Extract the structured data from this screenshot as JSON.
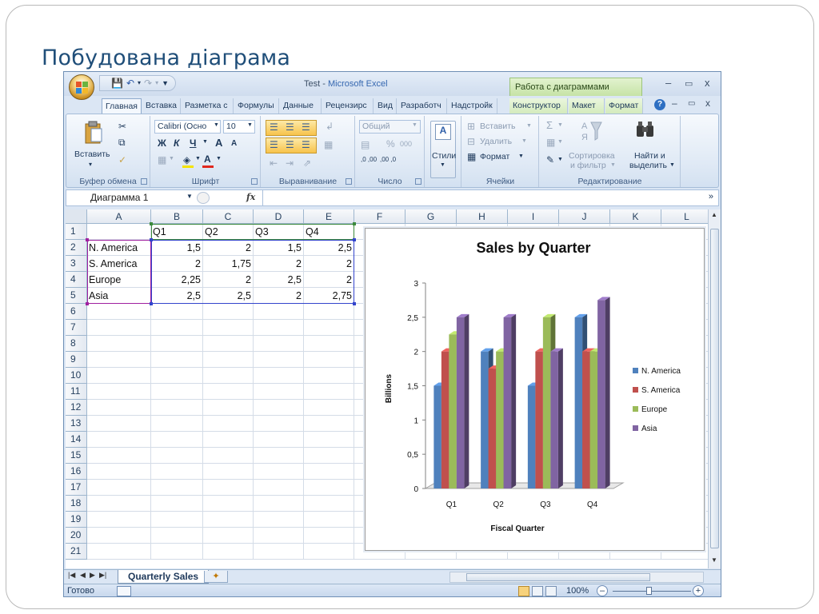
{
  "slide": {
    "title": "Побудована діаграма"
  },
  "window": {
    "title_file": "Test",
    "title_sep": " - ",
    "title_app": "Microsoft Excel",
    "context_title": "Работа с диаграммами",
    "minimize": "–",
    "maximize": "▭",
    "close": "x",
    "doc_minimize": "–",
    "doc_restore": "▭",
    "doc_close": "x",
    "help": "?"
  },
  "qat": {
    "save_icon": "save-icon",
    "undo_icon": "undo-icon",
    "redo_icon": "redo-icon"
  },
  "tabs": [
    "Главная",
    "Вставка",
    "Разметка с",
    "Формулы",
    "Данные",
    "Рецензирс",
    "Вид",
    "Разработч",
    "Надстройк",
    "Конструктор",
    "Макет",
    "Формат"
  ],
  "ribbon": {
    "clipboard": {
      "paste": "Вставить",
      "label": "Буфер обмена"
    },
    "font": {
      "name": "Calibri (Осно",
      "size": "10",
      "bold": "Ж",
      "italic": "К",
      "underline": "Ч",
      "grow": "A",
      "shrink": "A",
      "color_letter": "A",
      "label": "Шрифт"
    },
    "alignment": {
      "label": "Выравнивание"
    },
    "number": {
      "format": "Общий",
      "percent": "%",
      "thousands": "000",
      "inc": ",0 ,00",
      "dec": ",00 ,0",
      "label": "Число"
    },
    "styles": {
      "label": "Стили"
    },
    "cells": {
      "insert": "Вставить",
      "delete": "Удалить",
      "format": "Формат",
      "label": "Ячейки"
    },
    "editing": {
      "sum": "Σ",
      "sort_line1": "Сортировка",
      "sort_line2": "и фильтр",
      "find_line1": "Найти и",
      "find_line2": "выделить",
      "label": "Редактирование"
    }
  },
  "formula_bar": {
    "name_box": "Диаграмма 1",
    "fx": "fx",
    "formula": ""
  },
  "columns": [
    "A",
    "B",
    "C",
    "D",
    "E",
    "F",
    "G",
    "H",
    "I",
    "J",
    "K",
    "L"
  ],
  "rows": [
    "1",
    "2",
    "3",
    "4",
    "5",
    "6",
    "7",
    "8",
    "9",
    "10",
    "11",
    "12",
    "13",
    "14",
    "15",
    "16",
    "17",
    "18",
    "19",
    "20",
    "21"
  ],
  "table": {
    "header": [
      "",
      "Q1",
      "Q2",
      "Q3",
      "Q4"
    ],
    "rows": [
      [
        "N. America",
        "1,5",
        "2",
        "1,5",
        "2,5"
      ],
      [
        "S. America",
        "2",
        "1,75",
        "2",
        "2"
      ],
      [
        "Europe",
        "2,25",
        "2",
        "2,5",
        "2"
      ],
      [
        "Asia",
        "2,5",
        "2,5",
        "2",
        "2,75"
      ]
    ]
  },
  "chart_data": {
    "type": "bar",
    "title": "Sales by Quarter",
    "xlabel": "Fiscal Quarter",
    "ylabel": "Billions",
    "categories": [
      "Q1",
      "Q2",
      "Q3",
      "Q4"
    ],
    "series": [
      {
        "name": "N. America",
        "values": [
          1.5,
          2,
          1.5,
          2.5
        ],
        "color": "#4f81bd"
      },
      {
        "name": "S. America",
        "values": [
          2,
          1.75,
          2,
          2
        ],
        "color": "#c0504d"
      },
      {
        "name": "Europe",
        "values": [
          2.25,
          2,
          2.5,
          2
        ],
        "color": "#9bbb59"
      },
      {
        "name": "Asia",
        "values": [
          2.5,
          2.5,
          2,
          2.75
        ],
        "color": "#8064a2"
      }
    ],
    "ylim": [
      0,
      3
    ],
    "yticks": [
      "0",
      "0,5",
      "1",
      "1,5",
      "2",
      "2,5",
      "3"
    ],
    "legend": "right",
    "grid": false
  },
  "sheets": {
    "active": "Quarterly Sales",
    "new_sheet_icon": "insert-sheet-icon"
  },
  "status": {
    "ready": "Готово",
    "zoom": "100%",
    "zoom_minus": "–",
    "zoom_plus": "+"
  }
}
